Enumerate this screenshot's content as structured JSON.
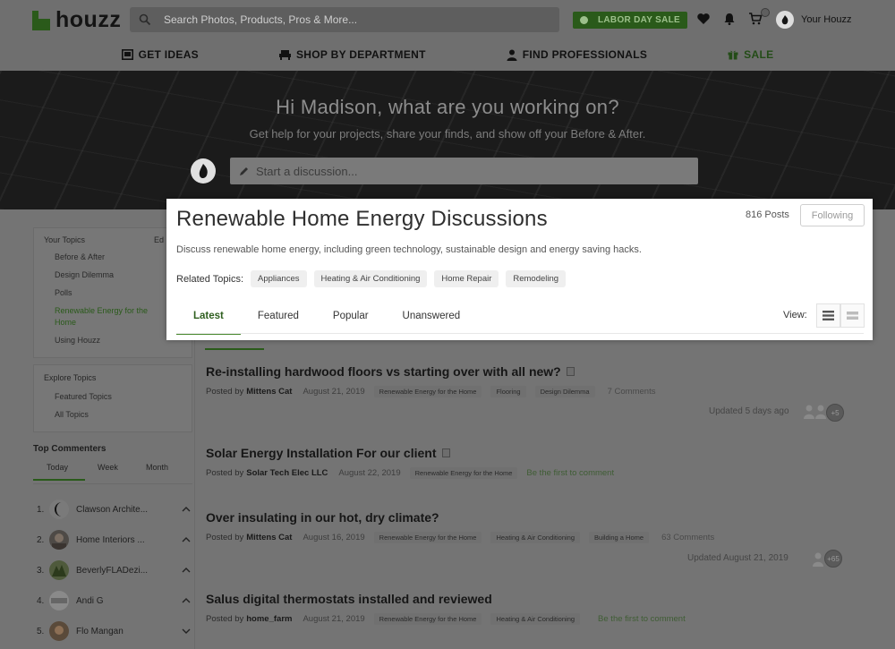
{
  "header": {
    "logo_text": "houzz",
    "search_placeholder": "Search Photos, Products, Pros & More...",
    "promo_label": "LABOR DAY SALE",
    "account_label": "Your Houzz"
  },
  "nav": {
    "items": [
      {
        "label": "GET IDEAS",
        "icon": "photo-icon"
      },
      {
        "label": "SHOP BY DEPARTMENT",
        "icon": "sofa-icon"
      },
      {
        "label": "FIND PROFESSIONALS",
        "icon": "person-icon"
      },
      {
        "label": "SALE",
        "icon": "gift-icon"
      }
    ]
  },
  "hero": {
    "greeting": "Hi Madison, what are you working on?",
    "subtitle": "Get help for your projects, share your finds, and show off your Before & After.",
    "discussion_placeholder": "Start a discussion..."
  },
  "sidebar": {
    "your_topics_title": "Your Topics",
    "edit_label": "Ed",
    "your_topics": [
      "Before & After",
      "Design Dilemma",
      "Polls",
      "Renewable Energy for the Home",
      "Using Houzz"
    ],
    "explore_title": "Explore Topics",
    "explore": [
      "Featured Topics",
      "All Topics"
    ],
    "commenters_title": "Top Commenters",
    "commenter_tabs": [
      "Today",
      "Week",
      "Month"
    ],
    "commenters": [
      {
        "rank": "1.",
        "name": "Clawson Archite..."
      },
      {
        "rank": "2.",
        "name": "Home Interiors ..."
      },
      {
        "rank": "3.",
        "name": "BeverlyFLADezi..."
      },
      {
        "rank": "4.",
        "name": "Andi G"
      },
      {
        "rank": "5.",
        "name": "Flo Mangan"
      }
    ]
  },
  "topic": {
    "title": "Renewable Home Energy Discussions",
    "posts_count": "816 Posts",
    "follow_label": "Following",
    "description": "Discuss renewable home energy, including green technology, sustainable design and energy saving hacks.",
    "related_label": "Related Topics:",
    "related": [
      "Appliances",
      "Heating & Air Conditioning",
      "Home Repair",
      "Remodeling"
    ],
    "tabs": [
      "Latest",
      "Featured",
      "Popular",
      "Unanswered"
    ],
    "view_label": "View:"
  },
  "posts": [
    {
      "title": "Re-installing hardwood floors vs starting over with all new?",
      "posted_by": "Posted by",
      "author": "Mittens Cat",
      "date": "August 21, 2019",
      "tags": [
        "Renewable Energy for the Home",
        "Flooring",
        "Design Dilemma"
      ],
      "comments": "7 Comments",
      "updated": "Updated 5 days ago",
      "more": "+5"
    },
    {
      "title": "Solar Energy Installation For our client",
      "posted_by": "Posted by",
      "author": "Solar Tech Elec LLC",
      "date": "August 22, 2019",
      "tags": [
        "Renewable Energy for the Home"
      ],
      "first_comment": "Be the first to comment"
    },
    {
      "title": "Over insulating in our hot, dry climate?",
      "posted_by": "Posted by",
      "author": "Mittens Cat",
      "date": "August 16, 2019",
      "tags": [
        "Renewable Energy for the Home",
        "Heating & Air Conditioning",
        "Building a Home"
      ],
      "comments": "63 Comments",
      "updated": "Updated August 21, 2019",
      "more": "+65"
    },
    {
      "title": "Salus digital thermostats installed and reviewed",
      "posted_by": "Posted by",
      "author": "home_farm",
      "date": "August 21, 2019",
      "tags": [
        "Renewable Energy for the Home",
        "Heating & Air Conditioning"
      ],
      "first_comment": "Be the first to comment"
    }
  ]
}
